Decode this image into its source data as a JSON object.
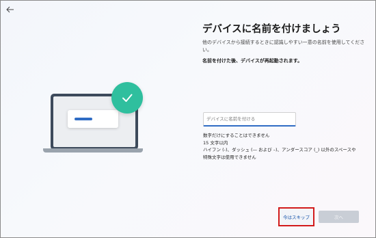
{
  "header": {
    "back_icon": "arrow-left-icon"
  },
  "illustration": {
    "laptop_icon": "laptop-icon",
    "check_icon": "checkmark-icon",
    "badge_color": "#2fbf9e",
    "bar_color": "#2f6cc4"
  },
  "content": {
    "title": "デバイスに名前を付けましょう",
    "description": "他のデバイスから接続するときに認識しやすい一意の名前を使用してください。",
    "note": "名前を付けた後、デバイスが再起動されます。"
  },
  "name_field": {
    "placeholder": "デバイスに名前を付ける",
    "value": ""
  },
  "rules": {
    "line1": "数字だけにすることはできません",
    "line2": "15 文字以内",
    "line3": "ハイフン (-)、ダッシュ (— および –)、アンダースコア (_) 以外のスペースや",
    "line4": "特殊文字は使用できません"
  },
  "footer": {
    "skip_label": "今はスキップ",
    "next_label": "次へ",
    "highlight_color": "#d21a1a"
  }
}
